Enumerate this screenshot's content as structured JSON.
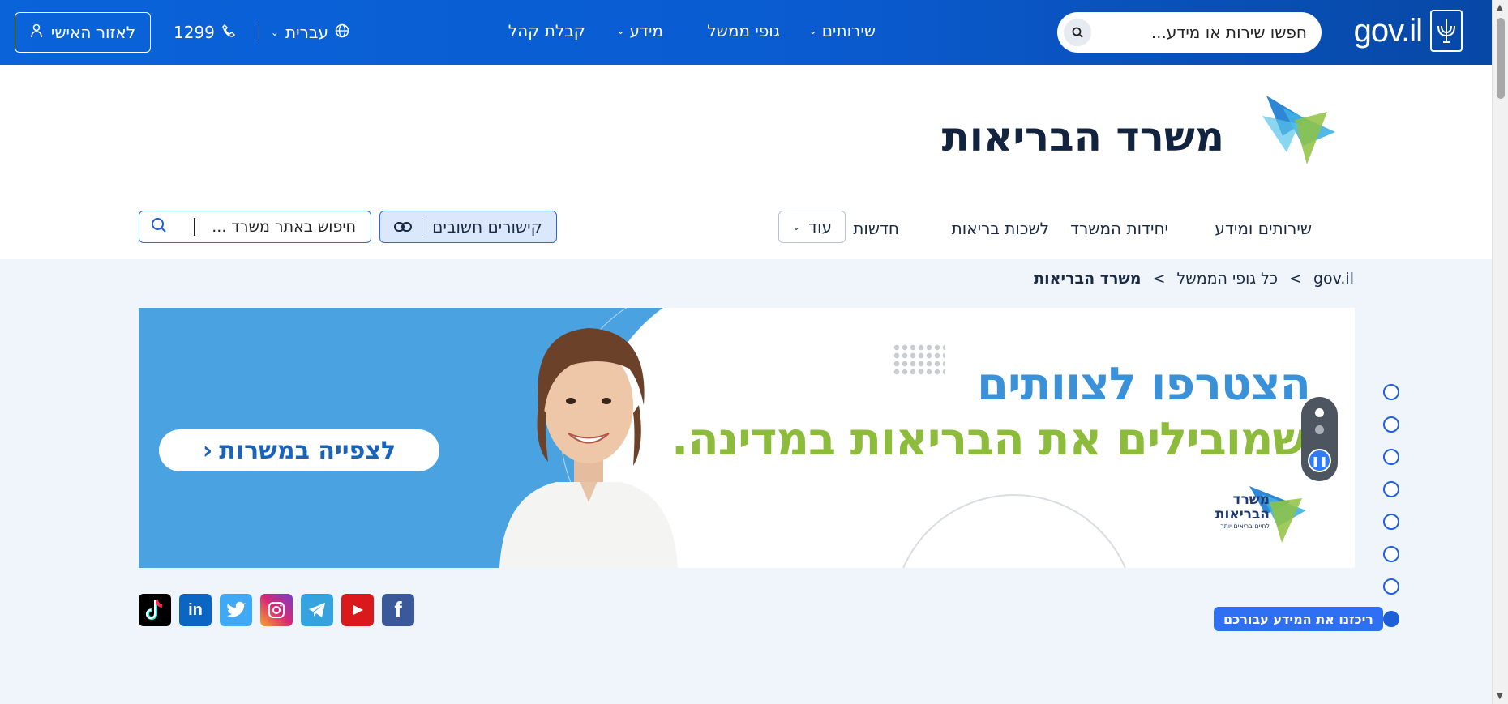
{
  "topbar": {
    "logo_text": "gov.il",
    "search_placeholder": "חפשו שירות או מידע...",
    "nav": [
      {
        "label": "שירותים",
        "has_dropdown": true
      },
      {
        "label": "גופי ממשל",
        "has_dropdown": false
      },
      {
        "label": "מידע",
        "has_dropdown": true
      },
      {
        "label": "קבלת קהל",
        "has_dropdown": false
      }
    ],
    "language": "עברית",
    "phone": "1299",
    "personal_area": "לאזור האישי"
  },
  "ministry": {
    "title": "משרד הבריאות",
    "nav": [
      "שירותים ומידע",
      "יחידות המשרד",
      "לשכות בריאות",
      "חדשות"
    ],
    "more_label": "עוד",
    "links_label": "קישורים חשובים",
    "search_placeholder": "חיפוש באתר משרד ..."
  },
  "breadcrumb": {
    "items": [
      "gov.il",
      "כל גופי הממשל"
    ],
    "current": "משרד הבריאות",
    "separator": ">"
  },
  "banner": {
    "headline_1": "הצטרפו לצוותים",
    "headline_2": "שמובילים את הבריאות במדינה.",
    "cta": "לצפייה במשרות",
    "logo_text_1": "משרד",
    "logo_text_2": "הבריאות",
    "logo_tagline": "לחיים בריאים יותר",
    "active_slide": 1,
    "slide_count": 2
  },
  "side_nav": {
    "dot_count": 8,
    "active_label": "ריכזנו את המידע עבורכם"
  },
  "social": [
    {
      "name": "facebook",
      "glyph": "f",
      "color": "#3b5998"
    },
    {
      "name": "youtube",
      "glyph": "▶",
      "color": "#e02020"
    },
    {
      "name": "telegram",
      "glyph": "➤",
      "color": "#35a4de"
    },
    {
      "name": "instagram",
      "glyph": "◎",
      "color": "#d62976"
    },
    {
      "name": "twitter",
      "glyph": "t",
      "color": "#3fa9f5"
    },
    {
      "name": "linkedin",
      "glyph": "in",
      "color": "#0a66c2"
    },
    {
      "name": "tiktok",
      "glyph": "♪",
      "color": "#ffffff"
    }
  ],
  "colors": {
    "topbar": "#0a63d9",
    "accent": "#1d5fd6",
    "banner_blue": "#4aa3e0",
    "banner_green": "#8dbb3b"
  }
}
